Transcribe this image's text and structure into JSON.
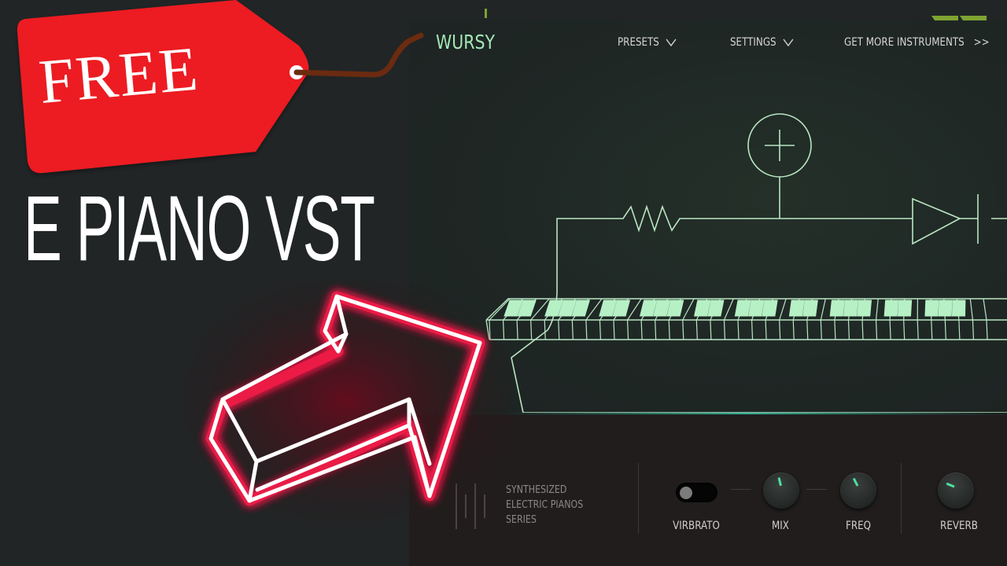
{
  "overlay": {
    "tag_label": "FREE",
    "headline": "E PIANO VST",
    "tag_color": "#ec1c24",
    "arrow_color": "#ff1f4b"
  },
  "plugin": {
    "logo": "WURSY",
    "logo_color": "#a5e8b6",
    "nav": {
      "presets_label": "PRESETS",
      "settings_label": "SETTINGS",
      "more_label": "GET MORE INSTRUMENTS",
      "more_suffix": ">>"
    },
    "series": {
      "line1": "SYNTHESIZED",
      "line2": "ELECTRIC PIANOS",
      "line3": "SERIES"
    },
    "controls": {
      "vibrato": {
        "label": "VIRBRATO",
        "on": false
      },
      "mix": {
        "label": "MIX",
        "value_fraction": 0.45
      },
      "freq": {
        "label": "FREQ",
        "value_fraction": 0.4
      },
      "reverb": {
        "label": "REVERB",
        "value_fraction": 0.25
      }
    },
    "accent_color": "#4fe0a0"
  }
}
